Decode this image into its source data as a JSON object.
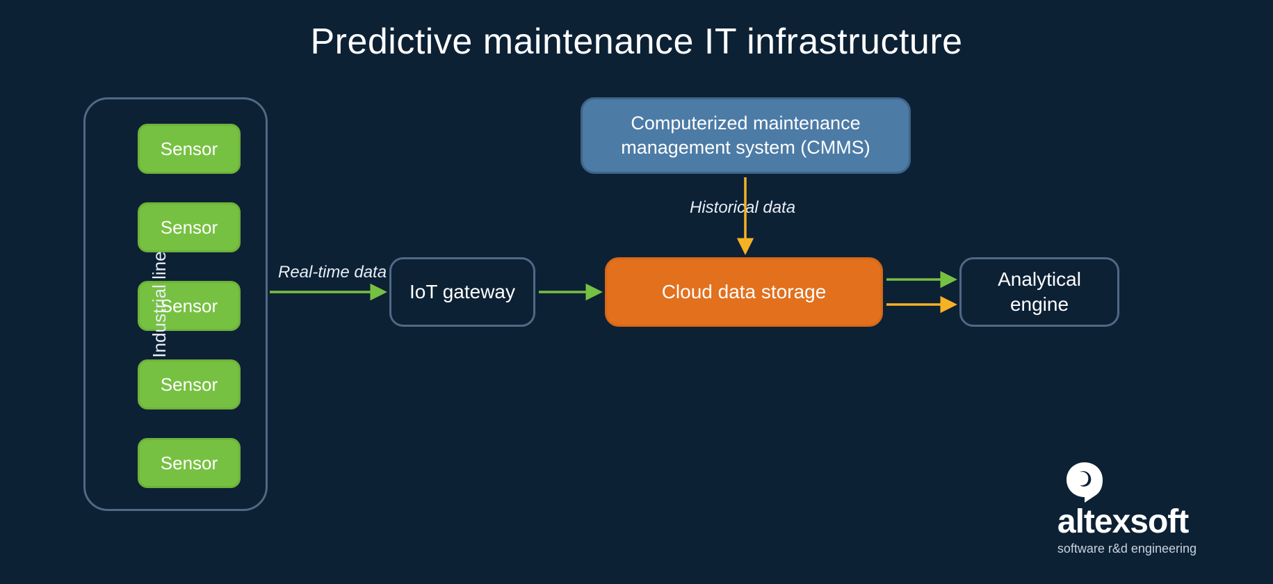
{
  "title": "Predictive maintenance IT infrastructure",
  "industrial": {
    "label": "Industrial line",
    "sensors": [
      "Sensor",
      "Sensor",
      "Sensor",
      "Sensor",
      "Sensor"
    ]
  },
  "nodes": {
    "iot_gateway": "IoT gateway",
    "cmms": "Computerized maintenance management system (CMMS)",
    "cloud": "Cloud data storage",
    "analytical": "Analytical engine"
  },
  "flows": {
    "real_time": "Real-time data",
    "historical": "Historical data"
  },
  "brand": {
    "name": "altexsoft",
    "tagline": "software r&d engineering"
  },
  "colors": {
    "bg": "#0d2135",
    "outline": "#4f6a84",
    "sensor": "#77c142",
    "blue": "#4c7ba6",
    "orange": "#e2701d",
    "arrow_green": "#77c142",
    "arrow_yellow": "#f6b224"
  }
}
